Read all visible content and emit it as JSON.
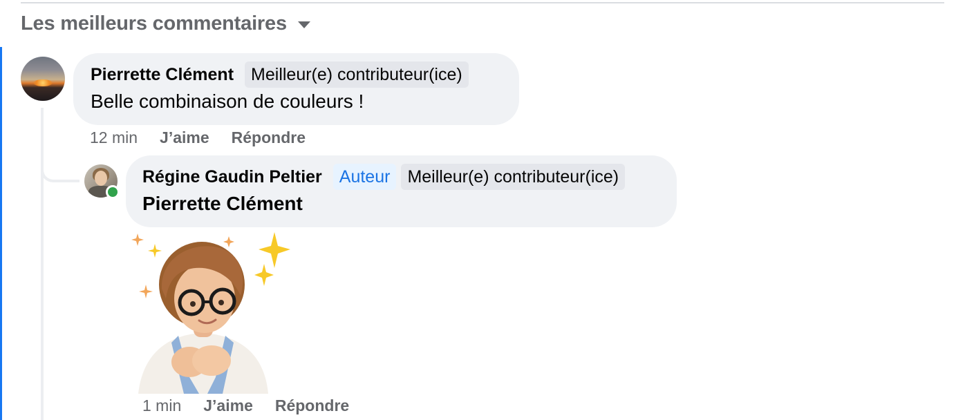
{
  "header": {
    "sort_label": "Les meilleurs commentaires"
  },
  "comments": [
    {
      "author": "Pierrette Clément",
      "badges": [
        "Meilleur(e) contributeur(ice)"
      ],
      "text": "Belle combinaison de couleurs !",
      "time": "12 min",
      "like_label": "J’aime",
      "reply_label": "Répondre",
      "avatar_icon": "sunset-photo-avatar"
    }
  ],
  "replies": [
    {
      "author": "Régine Gaudin Peltier",
      "author_badge": "Auteur",
      "badges": [
        "Meilleur(e) contributeur(ice)"
      ],
      "mention": "Pierrette Clément",
      "sticker": "memoji-woman-hands-on-heart-sparkles-sticker",
      "time": "1 min",
      "like_label": "J’aime",
      "reply_label": "Répondre",
      "online": true,
      "avatar_icon": "woman-photo-avatar"
    }
  ],
  "colors": {
    "accent": "#1877f2",
    "bubble": "#f0f2f5",
    "secondary_text": "#65676b",
    "author_badge_text": "#1b74e4",
    "online": "#31a24c"
  }
}
